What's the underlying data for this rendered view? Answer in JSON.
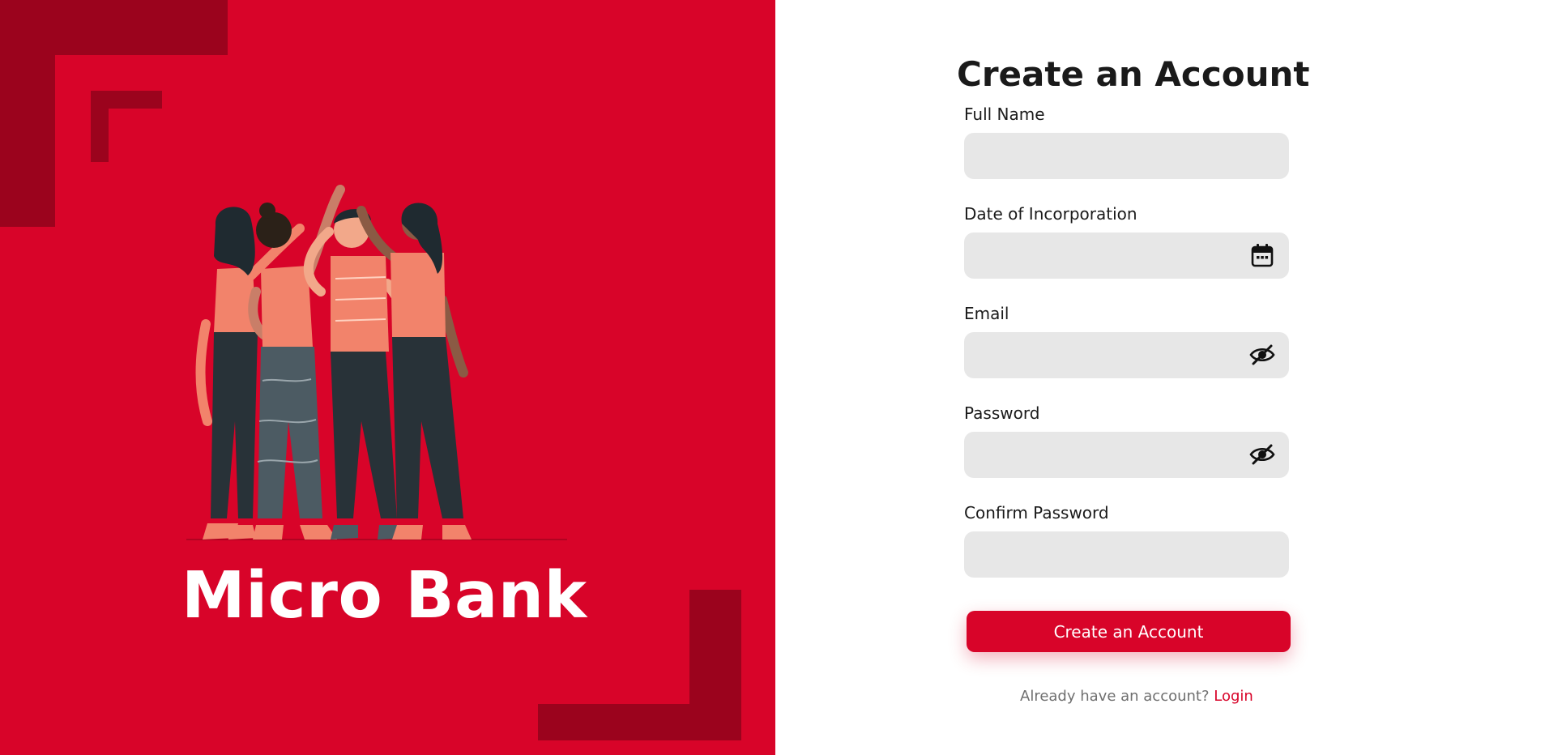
{
  "brand": {
    "name": "Micro Bank",
    "illustration": "four-people-high-five-illustration"
  },
  "colors": {
    "primary": "#d80429",
    "primary_dark": "#9b031d",
    "input_background": "#e7e7e7",
    "text": "#1a1a1a",
    "muted_text": "#6f6f6f"
  },
  "form": {
    "title": "Create an Account",
    "fields": [
      {
        "label": "Full Name",
        "value": "",
        "icon": null
      },
      {
        "label": "Date of Incorporation",
        "value": "",
        "icon": "calendar-icon"
      },
      {
        "label": "Email",
        "value": "",
        "icon": "eye-slash-icon"
      },
      {
        "label": "Password",
        "value": "",
        "icon": "eye-slash-icon"
      },
      {
        "label": "Confirm Password",
        "value": "",
        "icon": null
      }
    ],
    "submit_label": "Create an Account",
    "login_prompt": "Already have an account?",
    "login_link": "Login"
  }
}
